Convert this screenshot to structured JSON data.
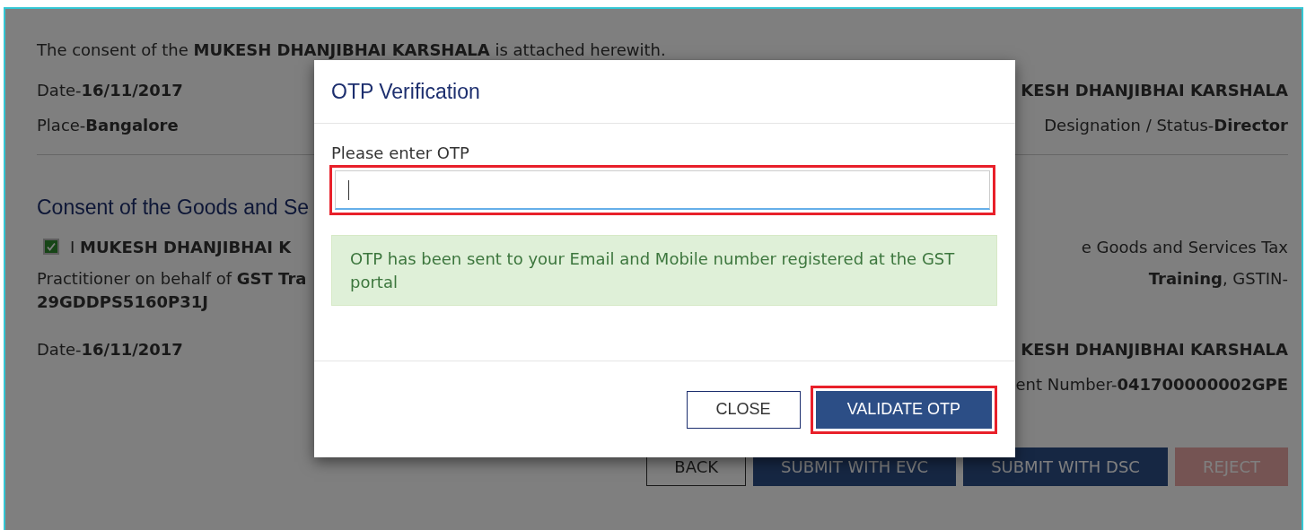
{
  "background_page": {
    "consent_note": "The consent of the **MUKESH DHANJIBHAI KARSHALA** is attached herewith.",
    "signatory_rows": [
      {
        "kind": "name",
        "left": "Date-**16/11/2017**",
        "right": "KESH DHANJIBHAI KARSHALA"
      },
      {
        "kind": "text",
        "left": "Place-**Bangalore**",
        "right": "Designation / Status-**Director**"
      }
    ],
    "section_title": "Consent of the Goods and Se",
    "declaration": {
      "checked": true,
      "left": "I **MUKESH DHANJIBHAI K**",
      "right": "e Goods and Services Tax"
    },
    "practitioner_line": {
      "left": "Practitioner on behalf of **GST Tra**",
      "right": "**Training**, GSTIN-"
    },
    "gstin": "29GDDPS5160P31J",
    "footer_rows": [
      {
        "kind": "name",
        "left": "Date-**16/11/2017**",
        "right": "KESH DHANJIBHAI KARSHALA"
      },
      {
        "kind": "text",
        "right": "ent Number-**041700000002GPE**"
      }
    ],
    "buttons": [
      {
        "label": "BACK",
        "kind": "outline",
        "disabled": false
      },
      {
        "label": "SUBMIT WITH EVC",
        "kind": "primary",
        "disabled": false
      },
      {
        "label": "SUBMIT WITH DSC",
        "kind": "primary",
        "disabled": false
      },
      {
        "label": "REJECT",
        "kind": "danger",
        "disabled": true
      }
    ]
  },
  "modal": {
    "title": "OTP Verification",
    "field": {
      "label": "Please enter OTP",
      "focused": true,
      "highlighted": true
    },
    "alert": "OTP has been sent to your Email and Mobile number registered at the GST portal",
    "buttons": [
      {
        "label": "CLOSE",
        "kind": "outline",
        "highlighted": false
      },
      {
        "label": "VALIDATE OTP",
        "kind": "primary",
        "highlighted": true
      }
    ]
  }
}
